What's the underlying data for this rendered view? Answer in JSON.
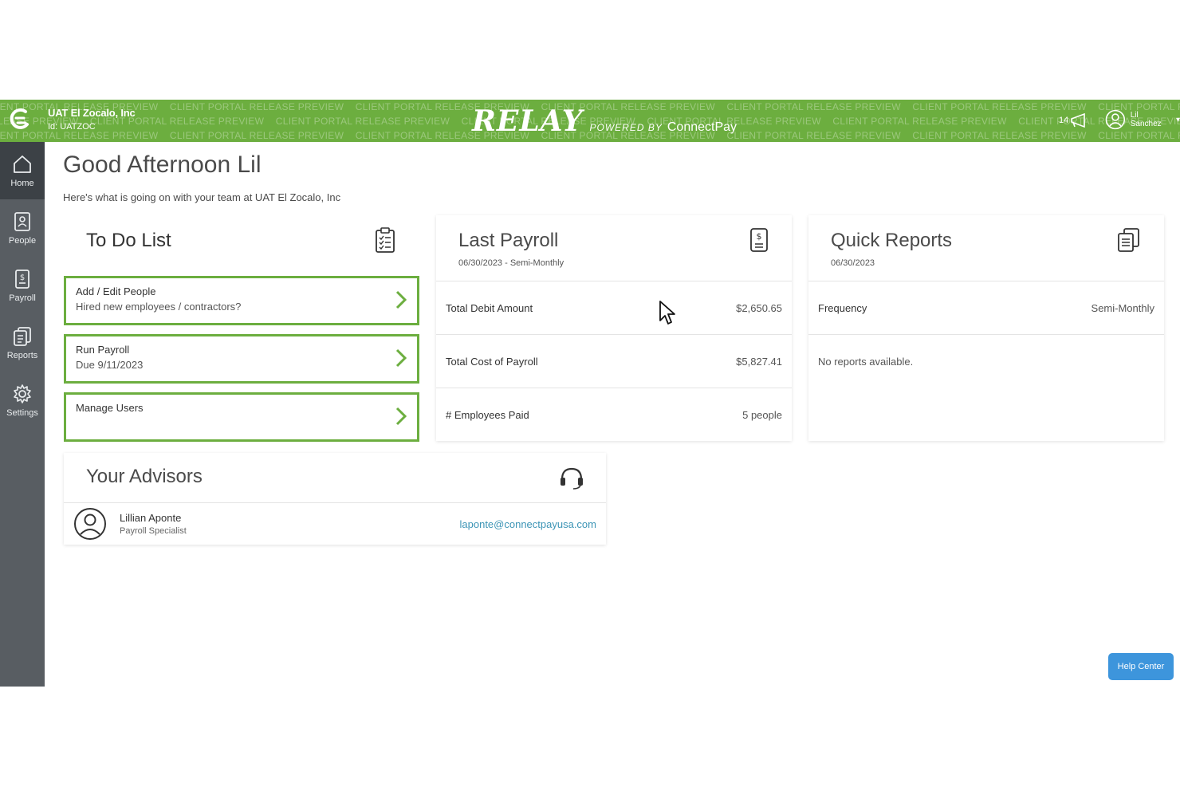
{
  "header": {
    "watermark_text": "CLIENT PORTAL RELEASE PREVIEW",
    "company_name": "UAT El Zocalo, Inc",
    "company_id": "Id: UATZOC",
    "brand_name": "RELAY",
    "powered_by": "POWERED BY",
    "powered_brand": "ConnectPay",
    "notification_count": "14",
    "user_name": "Lil Sanchez",
    "accent_color": "#6cae3f"
  },
  "sidebar": {
    "items": [
      {
        "label": "Home",
        "icon": "home-icon"
      },
      {
        "label": "People",
        "icon": "people-icon"
      },
      {
        "label": "Payroll",
        "icon": "payroll-icon"
      },
      {
        "label": "Reports",
        "icon": "reports-icon"
      },
      {
        "label": "Settings",
        "icon": "gear-icon"
      }
    ]
  },
  "main": {
    "greeting": "Good Afternoon Lil",
    "subtitle": "Here's what is going on with your team at UAT El Zocalo, Inc"
  },
  "todo": {
    "title": "To Do List",
    "items": [
      {
        "title": "Add / Edit People",
        "subtitle": "Hired new employees / contractors?"
      },
      {
        "title": "Run Payroll",
        "subtitle": "Due 9/11/2023"
      },
      {
        "title": "Manage Users",
        "subtitle": ""
      }
    ]
  },
  "last_payroll": {
    "title": "Last Payroll",
    "subtitle": "06/30/2023 - Semi-Monthly",
    "rows": [
      {
        "label": "Total Debit Amount",
        "value": "$2,650.65"
      },
      {
        "label": "Total Cost of Payroll",
        "value": "$5,827.41"
      },
      {
        "label": "# Employees Paid",
        "value": "5 people"
      }
    ]
  },
  "quick_reports": {
    "title": "Quick Reports",
    "subtitle": "06/30/2023",
    "frequency_label": "Frequency",
    "frequency_value": "Semi-Monthly",
    "empty_text": "No reports available."
  },
  "advisors": {
    "title": "Your Advisors",
    "items": [
      {
        "name": "Lillian Aponte",
        "role": "Payroll Specialist",
        "email": "laponte@connectpayusa.com"
      }
    ]
  },
  "help_center": {
    "label": "Help Center",
    "color": "#3d95dc"
  }
}
